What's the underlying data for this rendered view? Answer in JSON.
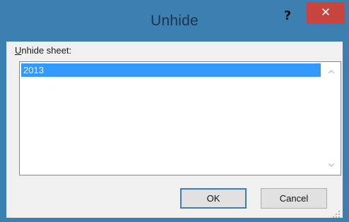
{
  "window": {
    "title": "Unhide",
    "help_label": "?",
    "close_label": "✕"
  },
  "sheet_list": {
    "label_access_key": "U",
    "label_rest": "nhide sheet:",
    "items": [
      "2013"
    ],
    "selected_index": 0
  },
  "buttons": {
    "ok_label": "OK",
    "cancel_label": "Cancel"
  },
  "icons": {
    "scroll_up": "chevron-up-icon",
    "scroll_down": "chevron-down-icon",
    "help": "help-icon",
    "close": "close-icon",
    "resize_grip": "resize-grip-icon"
  },
  "colors": {
    "title_bar": "#3c7fb1",
    "close_button": "#c7453c",
    "selection": "#3399ff",
    "client_bg": "#f0f0f0"
  }
}
